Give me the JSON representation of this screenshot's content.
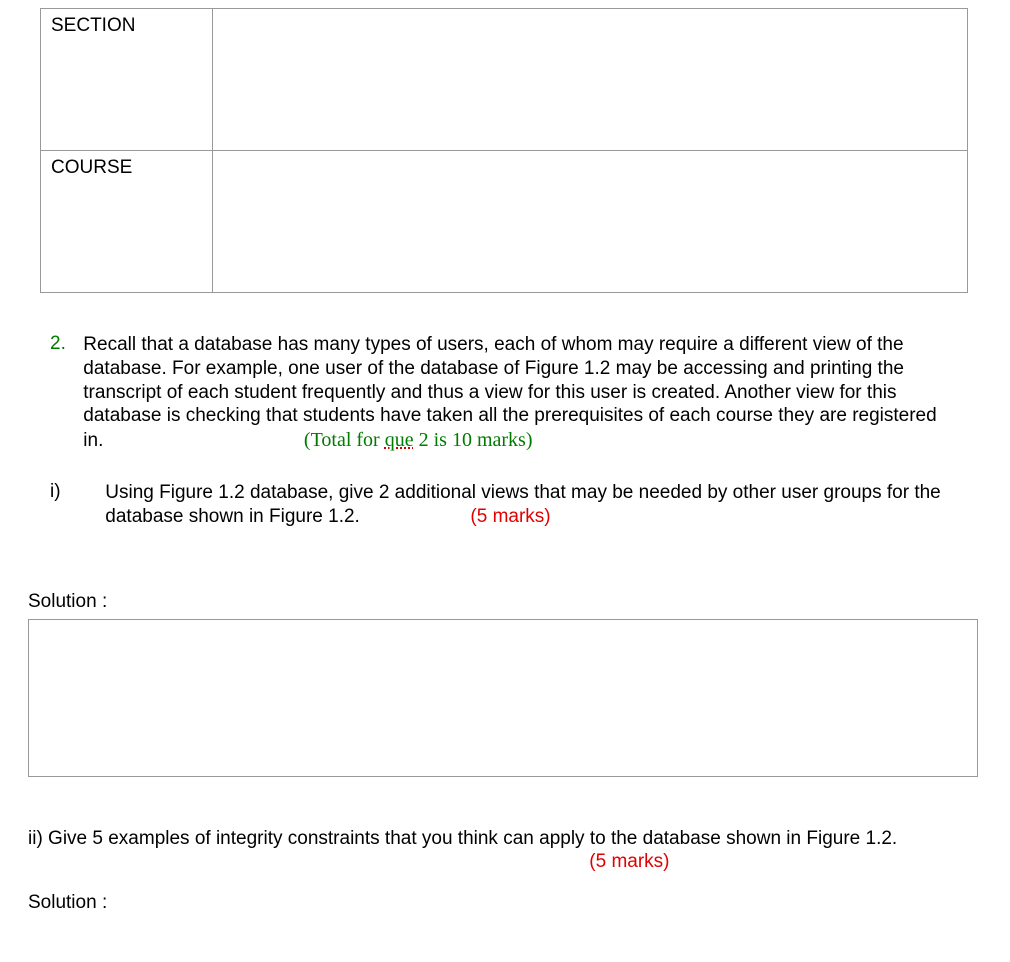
{
  "table": {
    "row1_label": "SECTION",
    "row1_value": "",
    "row2_label": "COURSE",
    "row2_value": ""
  },
  "question2": {
    "number": "2.",
    "text_part1": "Recall that a database has many types of users, each of whom may require a different view of the database. For example, one user of the database of Figure 1.2 may be accessing and printing the transcript of each student frequently and thus a view for this user is created. Another view for this database is checking that students have taken all the prerequisites of each course they are registered in.",
    "total_prefix": "(Total for ",
    "total_spellword": "que",
    "total_suffix": " 2 is 10 marks)"
  },
  "sub_i": {
    "label": "i)",
    "text": "Using Figure 1.2 database, give 2 additional views that may be needed by other user groups for the database shown in Figure 1.2.",
    "marks": "(5 marks)"
  },
  "solution_label": "Solution :",
  "sub_ii": {
    "text_prefix": "ii) Give 5 examples of integrity constraints that you think can apply to the database shown in Figure 1.2.",
    "marks": "(5 marks)"
  }
}
